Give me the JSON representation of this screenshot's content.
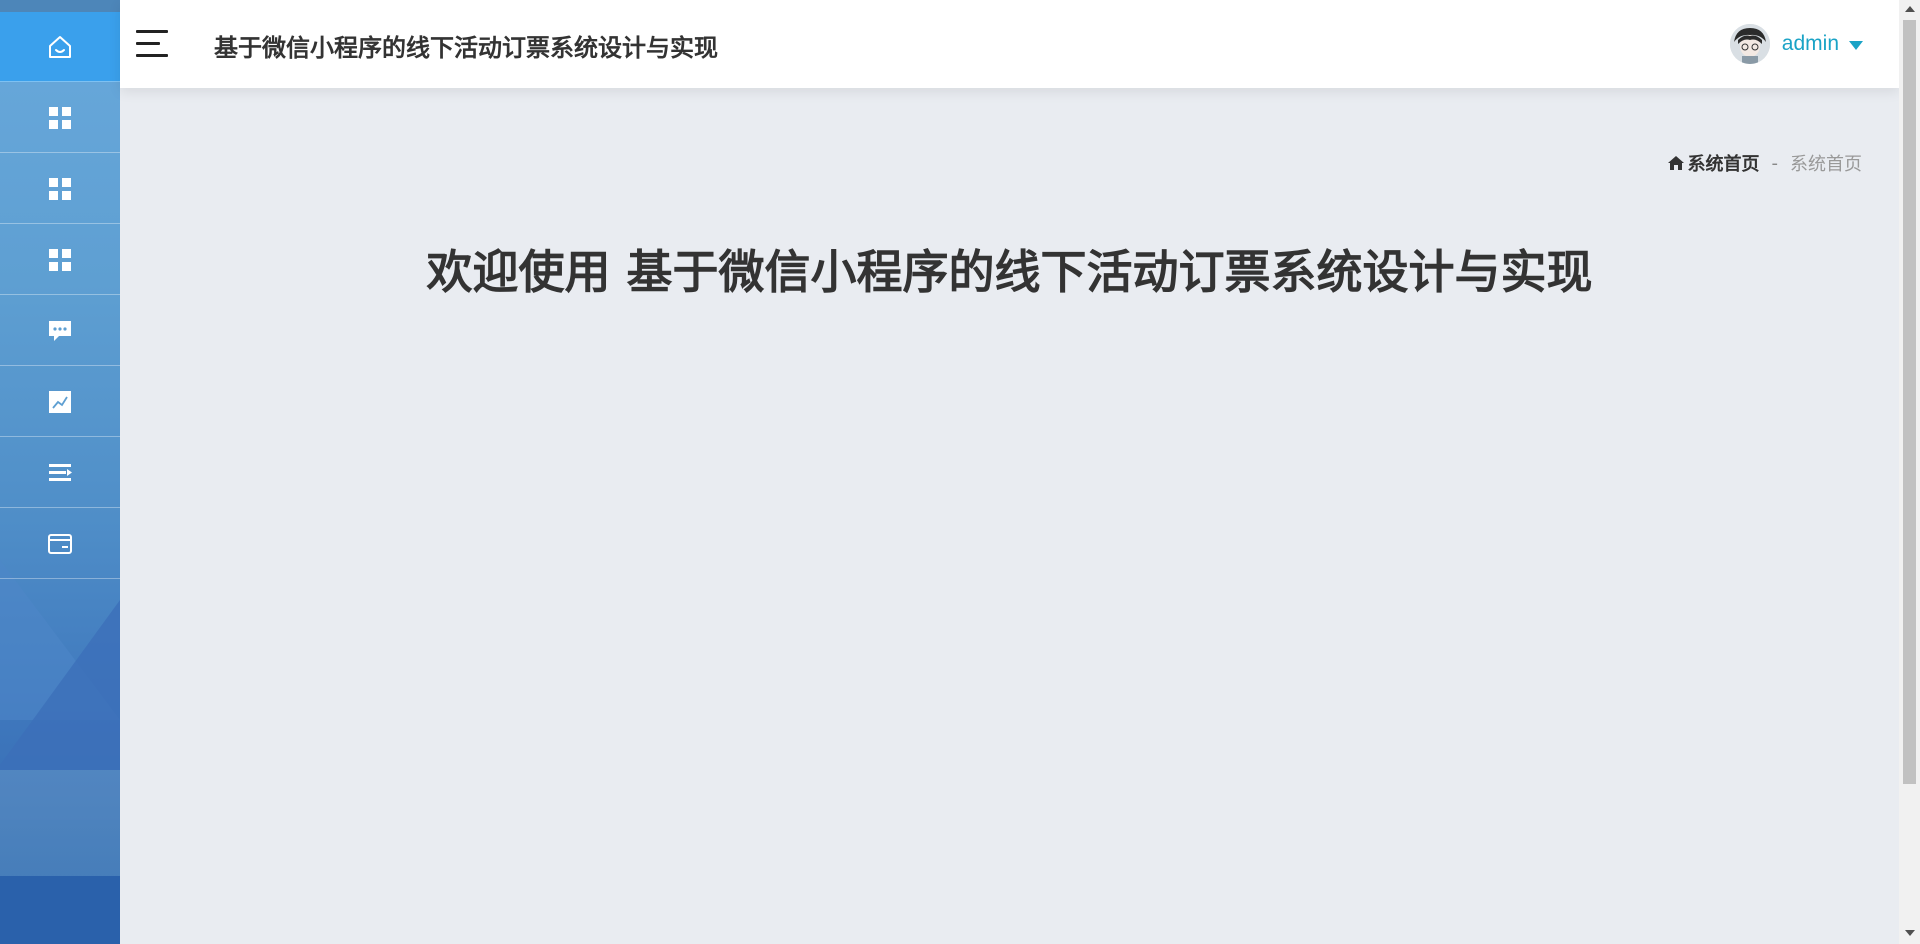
{
  "header": {
    "title": "基于微信小程序的线下活动订票系统设计与实现",
    "username": "admin"
  },
  "sidebar": {
    "items": [
      {
        "icon": "home-icon",
        "active": true
      },
      {
        "icon": "grid-icon",
        "active": false
      },
      {
        "icon": "grid-icon",
        "active": false
      },
      {
        "icon": "grid-icon",
        "active": false
      },
      {
        "icon": "chat-icon",
        "active": false
      },
      {
        "icon": "chart-icon",
        "active": false
      },
      {
        "icon": "list-icon",
        "active": false
      },
      {
        "icon": "card-icon",
        "active": false
      }
    ]
  },
  "breadcrumb": {
    "home_label": "系统首页",
    "separator": "-",
    "current": "系统首页"
  },
  "main": {
    "welcome": "欢迎使用 基于微信小程序的线下活动订票系统设计与实现"
  },
  "colors": {
    "accent": "#1aa3c6",
    "active_nav": "#3aa0ec",
    "background": "#e9ecf1"
  }
}
